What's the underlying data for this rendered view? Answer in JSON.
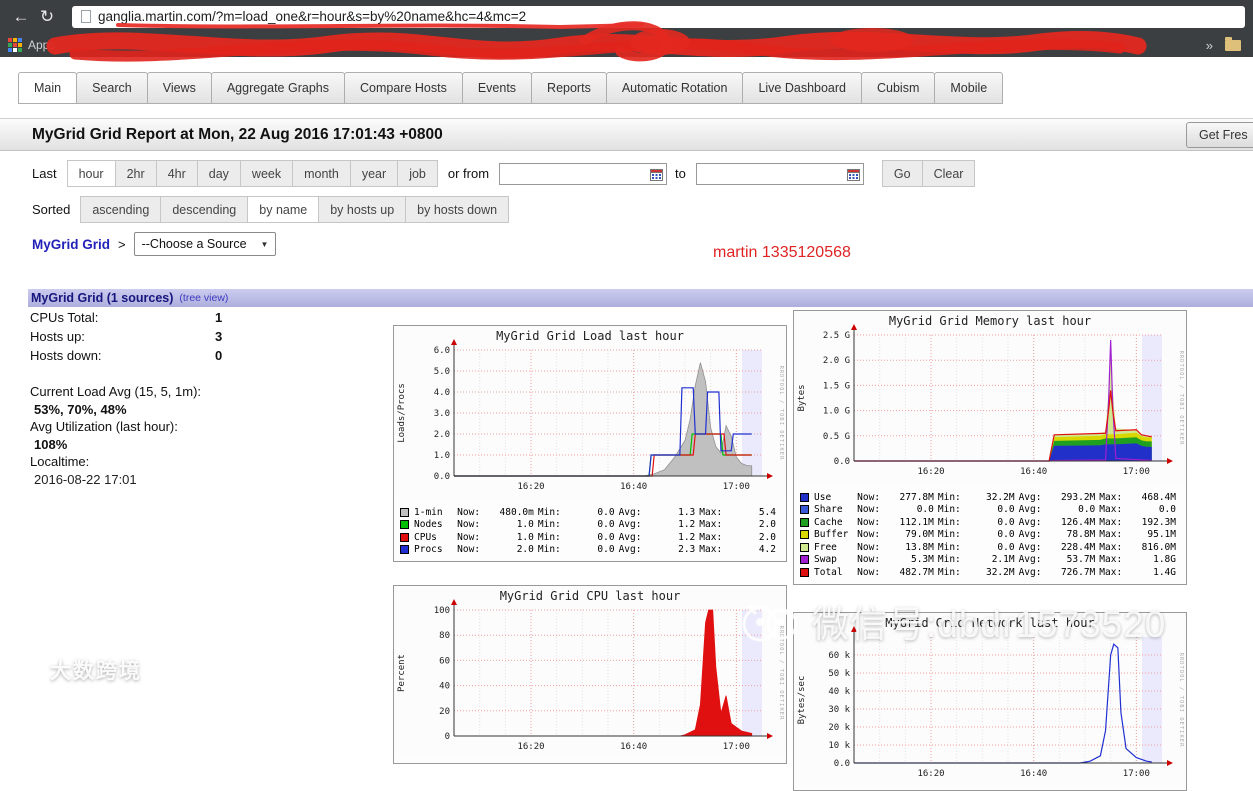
{
  "browser": {
    "url": "ganglia.martin.com/?m=load_one&r=hour&s=by%20name&hc=4&mc=2",
    "apps_label": "Apps",
    "overflow_chevron": "»"
  },
  "tabs": [
    {
      "label": "Main",
      "active": true
    },
    {
      "label": "Search"
    },
    {
      "label": "Views"
    },
    {
      "label": "Aggregate Graphs"
    },
    {
      "label": "Compare Hosts"
    },
    {
      "label": "Events"
    },
    {
      "label": "Reports"
    },
    {
      "label": "Automatic Rotation"
    },
    {
      "label": "Live Dashboard"
    },
    {
      "label": "Cubism"
    },
    {
      "label": "Mobile"
    }
  ],
  "header": {
    "title": "MyGrid Grid Report at Mon, 22 Aug 2016 17:01:43 +0800",
    "fresh_button": "Get Fres"
  },
  "time_controls": {
    "label": "Last",
    "ranges": [
      {
        "label": "hour",
        "active": true
      },
      {
        "label": "2hr"
      },
      {
        "label": "4hr"
      },
      {
        "label": "day"
      },
      {
        "label": "week"
      },
      {
        "label": "month"
      },
      {
        "label": "year"
      },
      {
        "label": "job"
      }
    ],
    "or_from_label": "or from",
    "to_label": "to",
    "go_label": "Go",
    "clear_label": "Clear"
  },
  "sort_controls": {
    "label": "Sorted",
    "options": [
      {
        "label": "ascending"
      },
      {
        "label": "descending"
      },
      {
        "label": "by name",
        "active": true
      },
      {
        "label": "by hosts up"
      },
      {
        "label": "by hosts down"
      }
    ]
  },
  "breadcrumb": {
    "grid_link": "MyGrid Grid",
    "separator": ">",
    "source_select": "--Choose a Source"
  },
  "annotation": "martin 1335120568",
  "section": {
    "title": "MyGrid Grid (1 sources)",
    "tree_view": "(tree view)"
  },
  "stats": [
    {
      "label": "CPUs Total:",
      "value": "1"
    },
    {
      "label": "Hosts up:",
      "value": "3"
    },
    {
      "label": "Hosts down:",
      "value": "0"
    }
  ],
  "stats2": [
    {
      "label": "Current Load Avg (15, 5, 1m):",
      "value": "53%, 70%, 48%"
    },
    {
      "label": "Avg Utilization (last hour):",
      "value": "108%"
    },
    {
      "label": "Localtime:",
      "value": "2016-08-22 17:01",
      "strong": false
    }
  ],
  "legend_labels": {
    "now": "Now:",
    "min": "Min:",
    "avg": "Avg:",
    "max": "Max:"
  },
  "rrd_watermark": "RRDTOOL / TOBI OETIKER",
  "watermarks": {
    "center_text": "微信号:dbdr1573520",
    "bottom_left_text": "大数跨境"
  },
  "chart_data": [
    {
      "type": "area",
      "title": "MyGrid Grid Load last hour",
      "ylabel": "Loads/Procs",
      "ylim": [
        0,
        6
      ],
      "yticks": [
        {
          "v": 0,
          "label": "0.0"
        },
        {
          "v": 1,
          "label": "1.0"
        },
        {
          "v": 2,
          "label": "2.0"
        },
        {
          "v": 3,
          "label": "3.0"
        },
        {
          "v": 4,
          "label": "4.0"
        },
        {
          "v": 5,
          "label": "5.0"
        },
        {
          "v": 6,
          "label": "6.0"
        }
      ],
      "xticks": [
        {
          "m": 15,
          "label": "16:20"
        },
        {
          "m": 35,
          "label": "16:40"
        },
        {
          "m": 55,
          "label": "17:00"
        }
      ],
      "series": [
        {
          "name": "1-min",
          "type": "area",
          "color": "#c0c0c0",
          "edge": "#909090",
          "points": [
            [
              0,
              0
            ],
            [
              37,
              0
            ],
            [
              39,
              0.1
            ],
            [
              41,
              0.3
            ],
            [
              43,
              0.9
            ],
            [
              45,
              1.7
            ],
            [
              46,
              2.7
            ],
            [
              47,
              4.3
            ],
            [
              48,
              5.4
            ],
            [
              49,
              4.5
            ],
            [
              50,
              2.3
            ],
            [
              51,
              1.4
            ],
            [
              52,
              1.1
            ],
            [
              53,
              2.4
            ],
            [
              54,
              1.9
            ],
            [
              55,
              0.9
            ],
            [
              56,
              0.6
            ],
            [
              57,
              0.5
            ],
            [
              58,
              0.48
            ]
          ]
        },
        {
          "name": "Nodes",
          "type": "line",
          "color": "#00c000",
          "points": [
            [
              0,
              0
            ],
            [
              38,
              0
            ],
            [
              38.4,
              1
            ],
            [
              46,
              1
            ],
            [
              46.4,
              2
            ],
            [
              52,
              2
            ],
            [
              52.4,
              1
            ],
            [
              58,
              1
            ]
          ]
        },
        {
          "name": "CPUs",
          "type": "line",
          "color": "#e01010",
          "points": [
            [
              0,
              0
            ],
            [
              38.6,
              0
            ],
            [
              39,
              1
            ],
            [
              46.6,
              1
            ],
            [
              47,
              2
            ],
            [
              52.6,
              2
            ],
            [
              53,
              1
            ],
            [
              58,
              1
            ]
          ]
        },
        {
          "name": "Procs",
          "type": "line",
          "color": "#2030d0",
          "points": [
            [
              0,
              0
            ],
            [
              38,
              0
            ],
            [
              38.4,
              1
            ],
            [
              44,
              1
            ],
            [
              44.4,
              4.2
            ],
            [
              46.6,
              4.2
            ],
            [
              47,
              2
            ],
            [
              49,
              2
            ],
            [
              49.4,
              4
            ],
            [
              51.6,
              4
            ],
            [
              52,
              1.2
            ],
            [
              54,
              1.2
            ],
            [
              54.4,
              2
            ],
            [
              58,
              2
            ]
          ]
        }
      ],
      "legend": [
        {
          "name": "1-min",
          "color": "#c0c0c0",
          "now": "480.0m",
          "min": "0.0",
          "avg": "1.3",
          "max": "5.4"
        },
        {
          "name": "Nodes",
          "color": "#00c000",
          "now": "1.0",
          "min": "0.0",
          "avg": "1.2",
          "max": "2.0"
        },
        {
          "name": "CPUs",
          "color": "#e01010",
          "now": "1.0",
          "min": "0.0",
          "avg": "1.2",
          "max": "2.0"
        },
        {
          "name": "Procs",
          "color": "#2030d0",
          "now": "2.0",
          "min": "0.0",
          "avg": "2.3",
          "max": "4.2"
        }
      ]
    },
    {
      "type": "stacked-area",
      "title": "MyGrid Grid Memory last hour",
      "ylabel": "Bytes",
      "ylim": [
        0,
        2.5
      ],
      "yticks": [
        {
          "v": 0,
          "label": "0.0"
        },
        {
          "v": 0.5,
          "label": "0.5 G"
        },
        {
          "v": 1,
          "label": "1.0 G"
        },
        {
          "v": 1.5,
          "label": "1.5 G"
        },
        {
          "v": 2,
          "label": "2.0 G"
        },
        {
          "v": 2.5,
          "label": "2.5 G"
        }
      ],
      "xticks": [
        {
          "m": 15,
          "label": "16:20"
        },
        {
          "m": 35,
          "label": "16:40"
        },
        {
          "m": 55,
          "label": "17:00"
        }
      ],
      "stack_x": [
        0,
        38,
        39,
        48,
        49,
        49.6,
        50,
        50.4,
        51,
        55,
        56,
        57,
        58
      ],
      "series": [
        {
          "name": "Use",
          "type": "stack",
          "color": "#2030c8",
          "values": [
            0,
            0,
            0.3,
            0.31,
            0.33,
            0.33,
            0.33,
            0.33,
            0.33,
            0.35,
            0.3,
            0.28,
            0.28
          ]
        },
        {
          "name": "Share",
          "type": "stack",
          "color": "#3858d8",
          "values": [
            0,
            0,
            0,
            0,
            0,
            0,
            0,
            0,
            0,
            0,
            0,
            0,
            0
          ]
        },
        {
          "name": "Cache",
          "type": "stack",
          "color": "#20a020",
          "values": [
            0,
            0,
            0.1,
            0.11,
            0.12,
            0.12,
            0.12,
            0.12,
            0.12,
            0.12,
            0.11,
            0.11,
            0.11
          ]
        },
        {
          "name": "Buffer",
          "type": "stack",
          "color": "#d8d800",
          "values": [
            0,
            0,
            0.07,
            0.08,
            0.08,
            0.08,
            0.08,
            0.08,
            0.08,
            0.09,
            0.08,
            0.08,
            0.08
          ]
        },
        {
          "name": "Free",
          "type": "stack",
          "color": "#d0e890",
          "values": [
            0,
            0,
            0.05,
            0.05,
            0.06,
            0.9,
            1.55,
            0.9,
            0.12,
            0.05,
            0.03,
            0.01,
            0.01
          ]
        },
        {
          "name": "Swap",
          "type": "line",
          "color": "#a020d0",
          "points": [
            [
              0,
              0
            ],
            [
              38,
              0
            ],
            [
              39,
              0.01
            ],
            [
              49,
              0.02
            ],
            [
              49.6,
              1.2
            ],
            [
              50,
              2.4
            ],
            [
              50.4,
              1.1
            ],
            [
              51,
              0.05
            ],
            [
              58,
              0.01
            ]
          ]
        },
        {
          "name": "Total",
          "type": "line",
          "color": "#e01010",
          "points": [
            [
              0,
              0
            ],
            [
              38,
              0
            ],
            [
              39,
              0.52
            ],
            [
              49,
              0.55
            ],
            [
              49.6,
              1.0
            ],
            [
              50,
              1.4
            ],
            [
              50.4,
              1.0
            ],
            [
              51,
              0.6
            ],
            [
              55,
              0.62
            ],
            [
              56,
              0.52
            ],
            [
              58,
              0.48
            ]
          ]
        }
      ],
      "legend": [
        {
          "name": "Use",
          "color": "#2030c8",
          "now": "277.8M",
          "min": "32.2M",
          "avg": "293.2M",
          "max": "468.4M"
        },
        {
          "name": "Share",
          "color": "#3858d8",
          "now": "0.0",
          "min": "0.0",
          "avg": "0.0",
          "max": "0.0"
        },
        {
          "name": "Cache",
          "color": "#20a020",
          "now": "112.1M",
          "min": "0.0",
          "avg": "126.4M",
          "max": "192.3M"
        },
        {
          "name": "Buffer",
          "color": "#d8d800",
          "now": "79.0M",
          "min": "0.0",
          "avg": "78.8M",
          "max": "95.1M"
        },
        {
          "name": "Free",
          "color": "#d0e890",
          "now": "13.8M",
          "min": "0.0",
          "avg": "228.4M",
          "max": "816.0M"
        },
        {
          "name": "Swap",
          "color": "#a020d0",
          "now": "5.3M",
          "min": "2.1M",
          "avg": "53.7M",
          "max": "1.8G"
        },
        {
          "name": "Total",
          "color": "#e01010",
          "now": "482.7M",
          "min": "32.2M",
          "avg": "726.7M",
          "max": "1.4G"
        }
      ]
    },
    {
      "type": "area",
      "title": "MyGrid Grid CPU last hour",
      "ylabel": "Percent",
      "ylim": [
        0,
        100
      ],
      "yticks": [
        {
          "v": 0,
          "label": "0"
        },
        {
          "v": 20,
          "label": "20"
        },
        {
          "v": 40,
          "label": "40"
        },
        {
          "v": 60,
          "label": "60"
        },
        {
          "v": 80,
          "label": "80"
        },
        {
          "v": 100,
          "label": "100"
        }
      ],
      "xticks": [
        {
          "m": 15,
          "label": "16:20"
        },
        {
          "m": 35,
          "label": "16:40"
        },
        {
          "m": 55,
          "label": "17:00"
        }
      ],
      "series": [
        {
          "name": "cpu",
          "type": "area",
          "color": "#e01010",
          "points": [
            [
              0,
              0
            ],
            [
              44,
              0
            ],
            [
              45,
              1
            ],
            [
              47,
              5
            ],
            [
              48,
              25
            ],
            [
              49,
              90
            ],
            [
              49.6,
              100
            ],
            [
              50.4,
              100
            ],
            [
              51,
              55
            ],
            [
              52,
              18
            ],
            [
              53,
              32
            ],
            [
              54,
              10
            ],
            [
              56,
              4
            ],
            [
              58,
              2
            ]
          ]
        }
      ],
      "legend": []
    },
    {
      "type": "line",
      "title": "MyGrid Grid Network last hour",
      "ylabel": "Bytes/sec",
      "ylim": [
        0,
        70
      ],
      "yticks": [
        {
          "v": 0,
          "label": "0.0"
        },
        {
          "v": 10,
          "label": "10 k"
        },
        {
          "v": 20,
          "label": "20 k"
        },
        {
          "v": 30,
          "label": "30 k"
        },
        {
          "v": 40,
          "label": "40 k"
        },
        {
          "v": 50,
          "label": "50 k"
        },
        {
          "v": 60,
          "label": "60 k"
        }
      ],
      "xticks": [
        {
          "m": 15,
          "label": "16:20"
        },
        {
          "m": 35,
          "label": "16:40"
        },
        {
          "m": 55,
          "label": "17:00"
        }
      ],
      "series": [
        {
          "name": "net",
          "type": "line",
          "color": "#2030d0",
          "points": [
            [
              0,
              0
            ],
            [
              44,
              0
            ],
            [
              46,
              1
            ],
            [
              48,
              4
            ],
            [
              49,
              18
            ],
            [
              50,
              60
            ],
            [
              50.6,
              66
            ],
            [
              51.4,
              64
            ],
            [
              52,
              28
            ],
            [
              53,
              8
            ],
            [
              55,
              3
            ],
            [
              57,
              1
            ],
            [
              58,
              0.6
            ]
          ]
        }
      ],
      "legend": []
    }
  ]
}
